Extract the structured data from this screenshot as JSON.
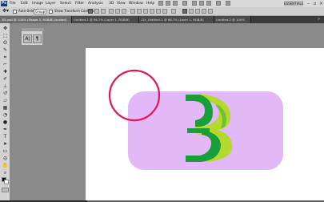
{
  "menubar": {
    "app_icon": "Ps",
    "items": [
      "File",
      "Edit",
      "Image",
      "Layer",
      "Select",
      "Filter",
      "Analysis",
      "3D",
      "View",
      "Window",
      "Help"
    ],
    "workspace": "ESSENTIALS"
  },
  "options": {
    "auto_select_label": "Auto-Select:",
    "auto_select_value": "Group",
    "show_transform_label": "Show Transform Controls"
  },
  "tabs": [
    {
      "label": "3D pod @ 100% (Shape 3, RGB/8) (scaled)",
      "active": true
    },
    {
      "label": "Untitled-1 @ 66.7% (Layer 1, RGB/8)",
      "active": false
    },
    {
      "label": "12c_Untitled-1 @ 66.7% (Layer 1, RGB/8)",
      "active": false
    },
    {
      "label": "Untitled-2 @ 100%",
      "active": false
    }
  ],
  "character_panel": {
    "button_a": "A|",
    "button_b": "¶"
  },
  "artwork": {
    "rounded_rect_color": "#e2b8f7",
    "circle_stroke_color": "#e0175e",
    "letter_dark_green": "#1a9e3a",
    "letter_light_green": "#b3d92c",
    "letter_mid_green": "#6cc230"
  },
  "icons": [
    "photoshop-app-icon",
    "move-tool-icon",
    "marquee-tool-icon",
    "lasso-tool-icon",
    "crop-tool-icon",
    "brush-tool-icon",
    "type-tool-icon",
    "hand-tool-icon",
    "zoom-tool-icon"
  ]
}
